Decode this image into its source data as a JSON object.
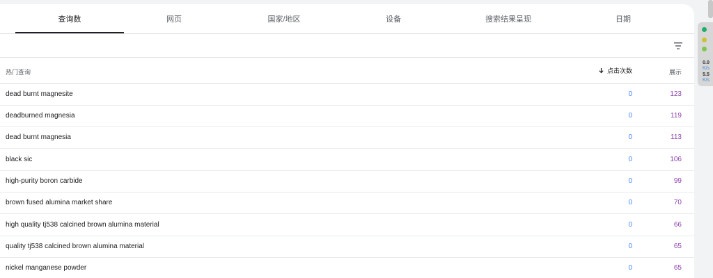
{
  "tabs": [
    {
      "label": "查询数",
      "active": true
    },
    {
      "label": "网页",
      "active": false
    },
    {
      "label": "国家/地区",
      "active": false
    },
    {
      "label": "设备",
      "active": false
    },
    {
      "label": "搜索结果呈现",
      "active": false
    },
    {
      "label": "日期",
      "active": false
    }
  ],
  "table": {
    "headers": {
      "query": "热门查询",
      "clicks": "点击次数",
      "impressions": "展示"
    },
    "sort_icon": "arrow-down-icon",
    "rows": [
      {
        "query": "dead burnt magnesite",
        "clicks": "0",
        "impressions": "123"
      },
      {
        "query": "deadburned magnesia",
        "clicks": "0",
        "impressions": "119"
      },
      {
        "query": "dead burnt magnesia",
        "clicks": "0",
        "impressions": "113"
      },
      {
        "query": "black sic",
        "clicks": "0",
        "impressions": "106"
      },
      {
        "query": "high-purity boron carbide",
        "clicks": "0",
        "impressions": "99"
      },
      {
        "query": "brown fused alumina market share",
        "clicks": "0",
        "impressions": "70"
      },
      {
        "query": "high quality tj538 calcined brown alumina material",
        "clicks": "0",
        "impressions": "66"
      },
      {
        "query": "quality tj538 calcined brown alumina material",
        "clicks": "0",
        "impressions": "65"
      },
      {
        "query": "nickel manganese powder",
        "clicks": "0",
        "impressions": "65"
      }
    ]
  },
  "side_widget": {
    "stat1_value": "0.0",
    "stat1_unit": "K/s",
    "stat2_value": "5.5",
    "stat2_unit": "K/s"
  },
  "colors": {
    "clicks": "#4285f4",
    "impressions": "#8e44ad",
    "active_tab": "#202124"
  }
}
